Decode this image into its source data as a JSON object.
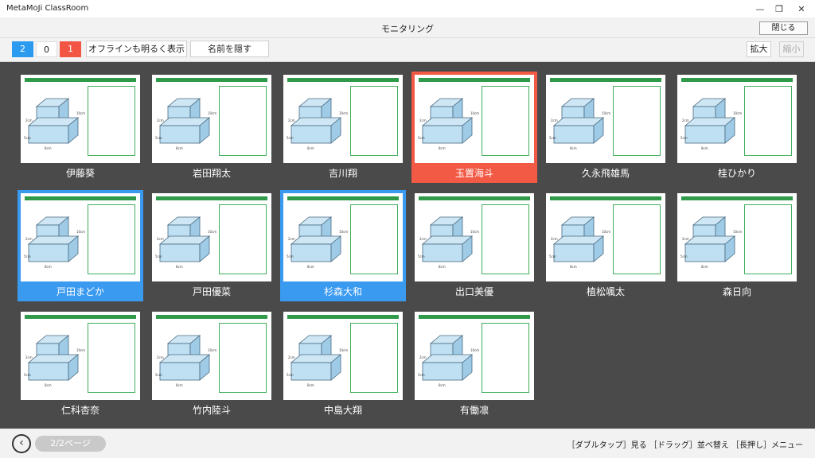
{
  "window": {
    "app_title": "MetaMoJi ClassRoom",
    "minimize_glyph": "—",
    "restore_glyph": "❐",
    "close_glyph": "✕"
  },
  "header": {
    "title": "モニタリング",
    "close_label": "閉じる"
  },
  "toolbar": {
    "count_blue": "2",
    "count_white": "0",
    "count_red": "1",
    "offline_label": "オフラインも明るく表示",
    "hide_names_label": "名前を隠す",
    "zoom_in_label": "拡大",
    "zoom_out_label": "縮小"
  },
  "thumb_common": {
    "label_2cm": "2cm",
    "label_5cm": "5cm",
    "label_8cm": "8cm",
    "label_10cm": "10cm"
  },
  "students": [
    {
      "name": "伊藤葵",
      "state": "normal"
    },
    {
      "name": "岩田翔太",
      "state": "normal"
    },
    {
      "name": "吉川翔",
      "state": "normal"
    },
    {
      "name": "玉置海斗",
      "state": "red"
    },
    {
      "name": "久永飛雄馬",
      "state": "normal"
    },
    {
      "name": "桂ひかり",
      "state": "normal"
    },
    {
      "name": "戸田まどか",
      "state": "blue"
    },
    {
      "name": "戸田優菜",
      "state": "normal"
    },
    {
      "name": "杉森大和",
      "state": "blue"
    },
    {
      "name": "出口美優",
      "state": "normal"
    },
    {
      "name": "植松颯太",
      "state": "normal"
    },
    {
      "name": "森日向",
      "state": "normal"
    },
    {
      "name": "仁科杏奈",
      "state": "normal"
    },
    {
      "name": "竹内陸斗",
      "state": "normal"
    },
    {
      "name": "中島大翔",
      "state": "normal"
    },
    {
      "name": "有働凛",
      "state": "normal"
    }
  ],
  "footer": {
    "page_label": "2/2ページ",
    "hints": "［ダブルタップ］見る ［ドラッグ］並べ替え ［長押し］メニュー"
  }
}
